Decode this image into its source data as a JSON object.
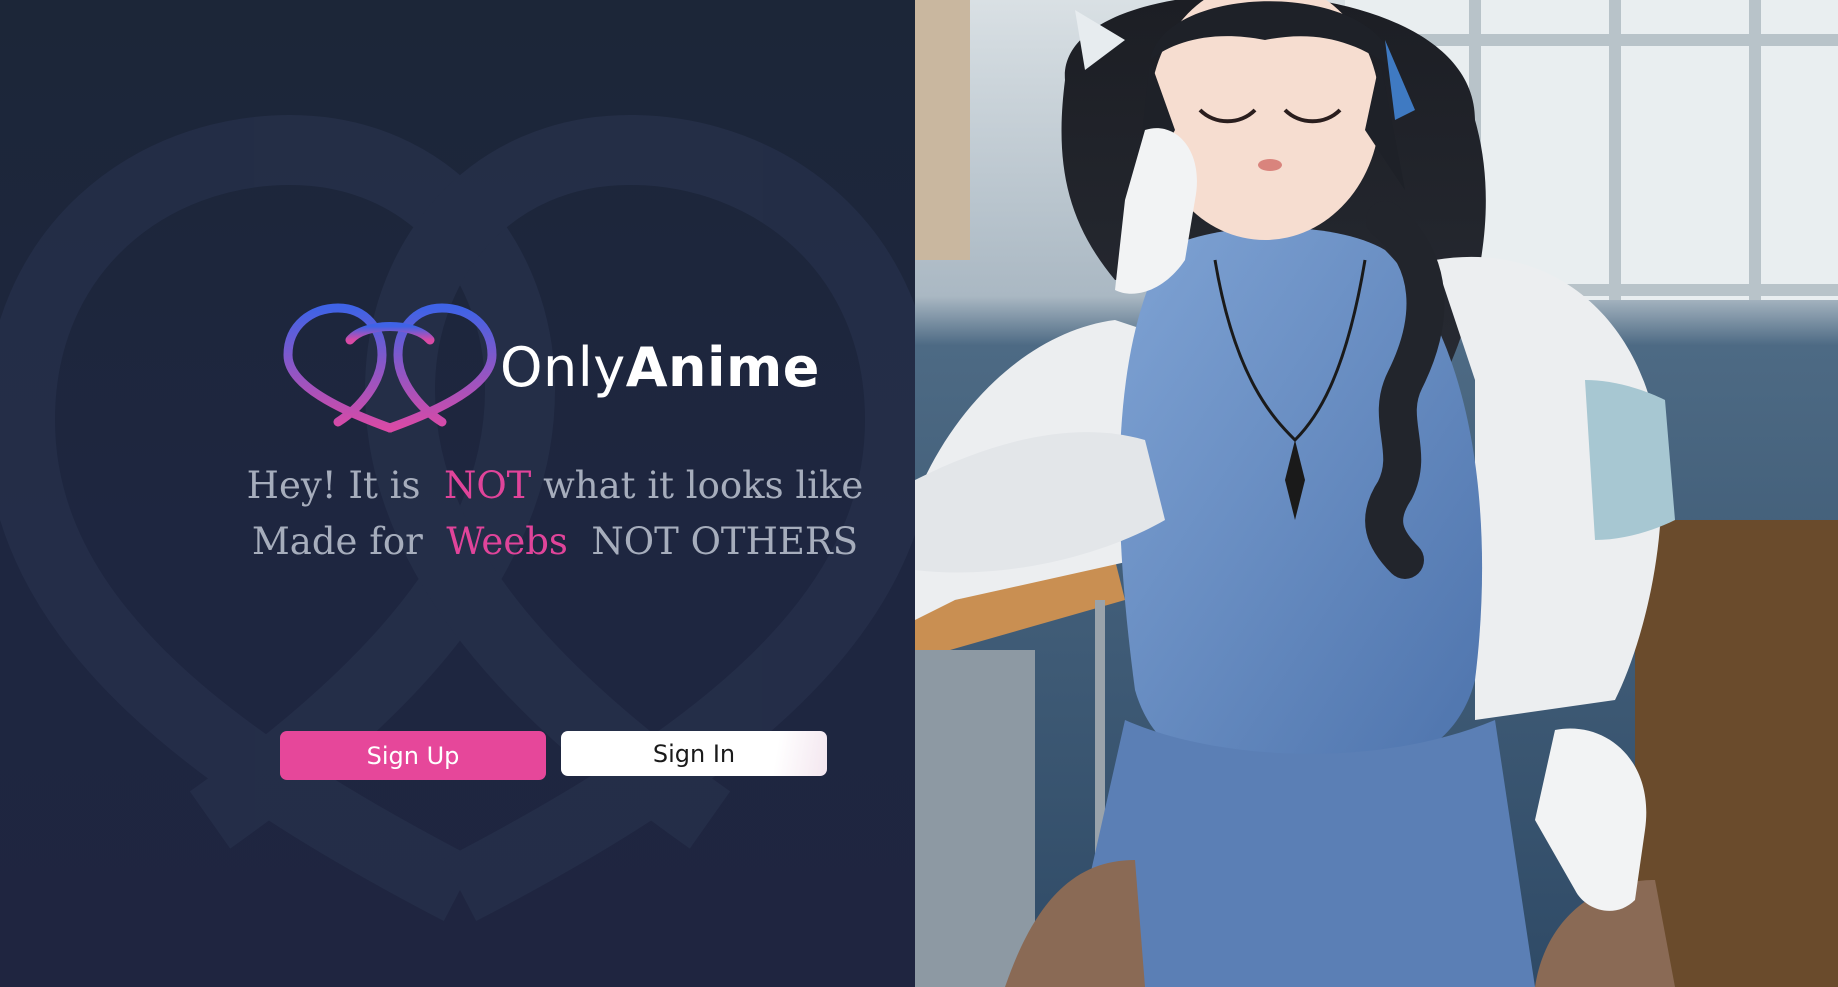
{
  "brand": {
    "name_part1": "Only",
    "name_part2": "Anime",
    "logo_icon": "interlocking-infinity-heart-logo"
  },
  "tagline": {
    "line1_pre": "Hey! It is",
    "line1_highlight": "NOT",
    "line1_post": "what it looks like",
    "line2_pre": "Made for",
    "line2_highlight": "Weebs",
    "line2_post": "NOT OTHERS"
  },
  "actions": {
    "signup_label": "Sign Up",
    "signin_label": "Sign In"
  },
  "colors": {
    "background": "#1c2638",
    "accent_pink": "#e6479a",
    "logo_gradient_top": "#3f63e6",
    "logo_gradient_bottom": "#d94aa6",
    "tagline_text": "#a6adbc"
  },
  "hero_image": {
    "subject": "anime-girl-classroom-illustration"
  }
}
